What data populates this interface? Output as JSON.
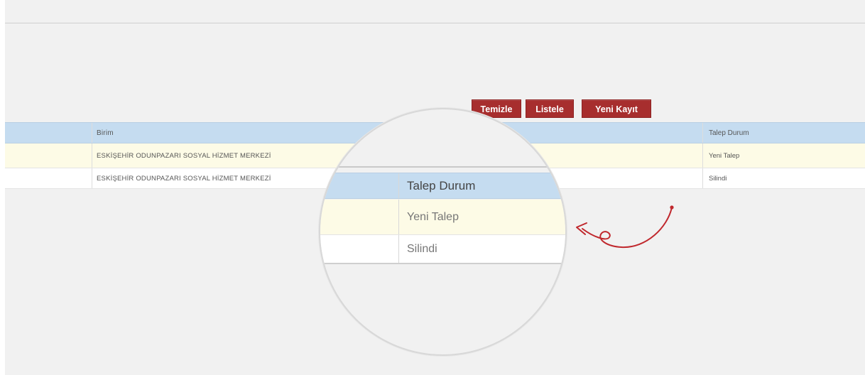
{
  "toolbar": {
    "clear_label": "Temizle",
    "list_label": "Listele",
    "new_label": "Yeni Kayıt"
  },
  "table": {
    "columns": [
      "Birim",
      "Talep Durum"
    ],
    "rows": [
      {
        "birim": "ESKİŞEHİR ODUNPAZARI SOSYAL HİZMET MERKEZİ",
        "durum": "Yeni Talep"
      },
      {
        "birim": "ESKİŞEHİR ODUNPAZARI SOSYAL HİZMET MERKEZİ",
        "durum": "Silindi"
      }
    ]
  },
  "zoom": {
    "header": "Talep Durum",
    "values": [
      "Yeni Talep",
      "Silindi"
    ]
  },
  "colors": {
    "button": "#a72e2e",
    "header_row": "#c5dcf0",
    "highlight_row": "#fdfbe6",
    "arrow": "#c0282d"
  }
}
